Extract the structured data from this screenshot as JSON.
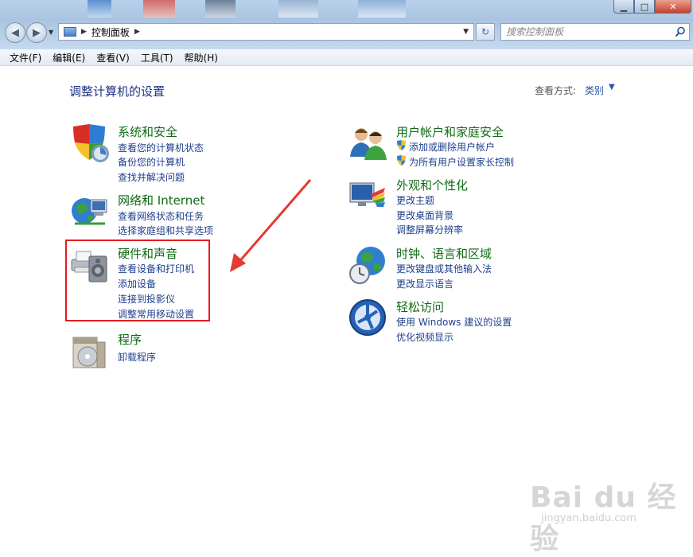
{
  "window": {
    "minimize": "▁",
    "maximize": "□",
    "close": "✕"
  },
  "address": {
    "crumb": "控制面板"
  },
  "search": {
    "placeholder": "搜索控制面板"
  },
  "menu": [
    "文件(F)",
    "编辑(E)",
    "查看(V)",
    "工具(T)",
    "帮助(H)"
  ],
  "heading": "调整计算机的设置",
  "view_by": {
    "label": "查看方式:",
    "value": "类别"
  },
  "categories": {
    "system": {
      "title": "系统和安全",
      "links": [
        "查看您的计算机状态",
        "备份您的计算机",
        "查找并解决问题"
      ]
    },
    "network": {
      "title": "网络和 Internet",
      "links": [
        "查看网络状态和任务",
        "选择家庭组和共享选项"
      ]
    },
    "hardware": {
      "title": "硬件和声音",
      "links": [
        "查看设备和打印机",
        "添加设备",
        "连接到投影仪",
        "调整常用移动设置"
      ]
    },
    "programs": {
      "title": "程序",
      "links": [
        "卸载程序"
      ]
    },
    "users": {
      "title": "用户帐户和家庭安全",
      "links": [
        "添加或删除用户帐户",
        "为所有用户设置家长控制"
      ]
    },
    "appearance": {
      "title": "外观和个性化",
      "links": [
        "更改主题",
        "更改桌面背景",
        "调整屏幕分辨率"
      ]
    },
    "clock": {
      "title": "时钟、语言和区域",
      "links": [
        "更改键盘或其他输入法",
        "更改显示语言"
      ]
    },
    "access": {
      "title": "轻松访问",
      "links": [
        "使用 Windows 建议的设置",
        "优化视频显示"
      ]
    }
  },
  "watermark": {
    "main": "Bai du 经验",
    "sub": "jingyan.baidu.com"
  },
  "colors": {
    "title_green": "#0f6a15",
    "link_blue": "#1e3f8c",
    "highlight_red": "#e51c1c"
  }
}
